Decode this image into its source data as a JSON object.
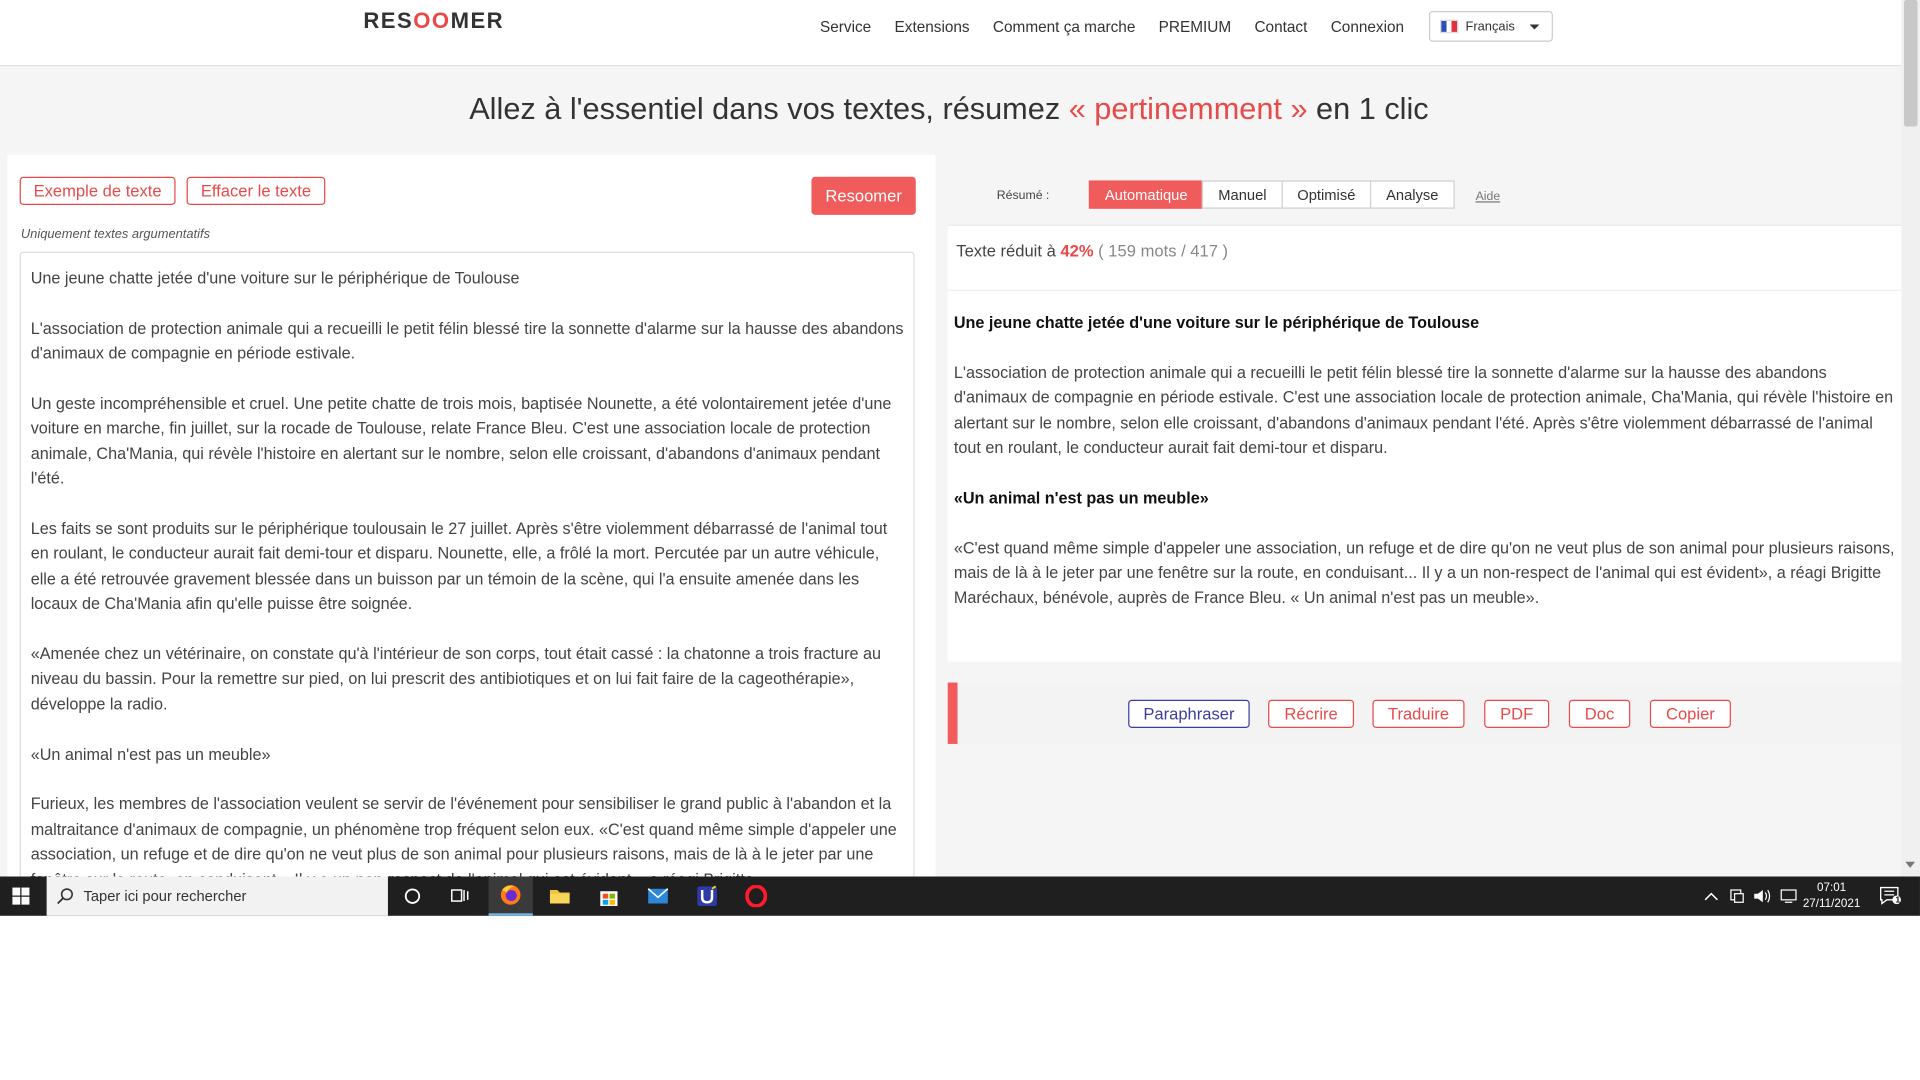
{
  "header": {
    "logo_prefix": "RES",
    "logo_accent": "OO",
    "logo_suffix": "MER",
    "nav": [
      "Service",
      "Extensions",
      "Comment ça marche",
      "PREMIUM",
      "Contact",
      "Connexion"
    ],
    "language": "Français"
  },
  "headline": {
    "before": "Allez à l'essentiel dans vos textes, résumez ",
    "highlight": "« pertinemment »",
    "after": " en 1 clic"
  },
  "left": {
    "example_button": "Exemple de texte",
    "clear_button": "Effacer le texte",
    "summarize_button": "Resoomer",
    "note": "Uniquement textes argumentatifs",
    "paragraphs": [
      "Une jeune chatte jetée d'une voiture sur le périphérique de Toulouse",
      "L'association de protection animale qui a recueilli le petit félin blessé tire la sonnette d'alarme sur la hausse des abandons d'animaux de compagnie en période estivale.",
      "Un geste incompréhensible et cruel. Une petite chatte de trois mois, baptisée Nounette, a été volontairement jetée d'une voiture en marche, fin juillet, sur la rocade de Toulouse, relate France Bleu. C'est une association locale de protection animale, Cha'Mania, qui révèle l'histoire en alertant sur le nombre, selon elle croissant, d'abandons d'animaux pendant l'été.",
      "Les faits se sont produits sur le périphérique toulousain le 27 juillet. Après s'être violemment débarrassé de l'animal tout en roulant, le conducteur aurait fait demi-tour et disparu. Nounette, elle, a frôlé la mort. Percutée par un autre véhicule, elle a été retrouvée gravement blessée dans un buisson par un témoin de la scène, qui l'a ensuite amenée dans les locaux de Cha'Mania afin qu'elle puisse être soignée.",
      "«Amenée chez un vétérinaire, on constate qu'à l'intérieur de son corps, tout était cassé : la chatonne a trois fracture au niveau du bassin. Pour la remettre sur pied, on lui prescrit des antibiotiques et on lui fait faire de la cageothérapie», développe la radio.",
      "«Un animal n'est pas un meuble»",
      "Furieux, les membres de l'association veulent se servir de l'événement pour sensibiliser le grand public à l'abandon et la maltraitance d'animaux de compagnie, un phénomène trop fréquent selon eux. «C'est quand même simple d'appeler une association, un refuge et de dire qu'on ne veut plus de son animal pour plusieurs raisons, mais de là à le jeter par une fenêtre sur la route, en conduisant... Il y a un non-respect de l'animal qui est évident», a réagi Brigitte"
    ]
  },
  "right": {
    "resume_label": "Résumé :",
    "tabs": [
      "Automatique",
      "Manuel",
      "Optimisé",
      "Analyse"
    ],
    "active_tab": "Automatique",
    "help_link": "Aide",
    "reduced_prefix": "Texte réduit à ",
    "reduced_percent": "42%",
    "reduced_counts": " ( 159 mots / 417 )",
    "summary_title": "Une jeune chatte jetée d'une voiture sur le périphérique de Toulouse",
    "summary_p1": "L'association de protection animale qui a recueilli le petit félin blessé tire la sonnette d'alarme sur la hausse des abandons d'animaux de compagnie en période estivale. C'est une association locale de protection animale, Cha'Mania, qui révèle l'histoire en alertant sur le nombre, selon elle croissant, d'abandons d'animaux pendant l'été. Après s'être violemment débarrassé de l'animal tout en roulant, le conducteur aurait fait demi-tour et disparu.",
    "summary_subtitle": "«Un animal n'est pas un meuble»",
    "summary_p2": "«C'est quand même simple d'appeler une association, un refuge et de dire qu'on ne veut plus de son animal pour plusieurs raisons, mais de là à le jeter par une fenêtre sur la route, en conduisant... Il y a un non-respect de l'animal qui est évident», a réagi Brigitte Maréchaux, bénévole, auprès de France Bleu. « Un animal n'est pas un meuble».",
    "actions": [
      "Paraphraser",
      "Récrire",
      "Traduire",
      "PDF",
      "Doc",
      "Copier"
    ]
  },
  "taskbar": {
    "search_placeholder": "Taper ici pour rechercher",
    "time": "07:01",
    "date": "27/11/2021",
    "notification_count": "1",
    "apps": [
      "cortana-icon",
      "task-view-icon",
      "firefox-icon",
      "file-explorer-icon",
      "store-icon",
      "mail-icon",
      "app-u-icon",
      "opera-icon"
    ]
  },
  "colors": {
    "accent": "#e84a4a",
    "button_red": "#f05b5b",
    "paraphrase_blue": "#3a3f9a",
    "taskbar": "#1f1f1f"
  }
}
